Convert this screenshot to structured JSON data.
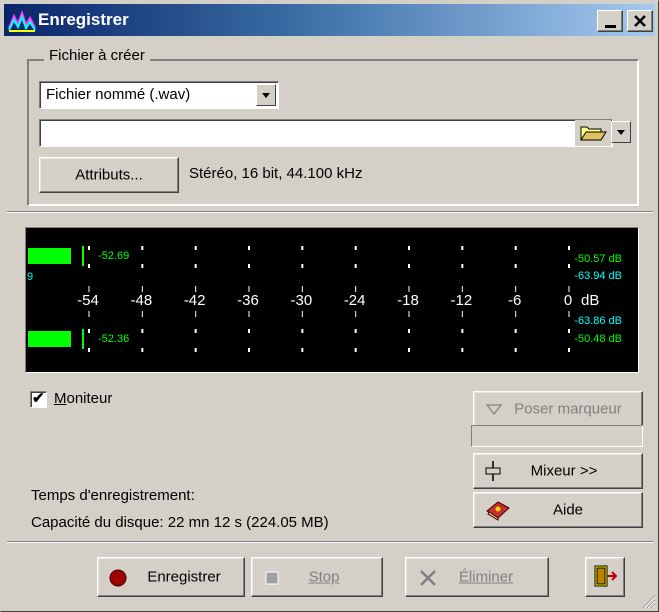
{
  "window": {
    "title": "Enregistrer"
  },
  "file_group": {
    "legend": "Fichier à créer",
    "file_type_value": "Fichier nommé (.wav)",
    "path_value": "",
    "attributes_button": "Attributs...",
    "format_text": "Stéréo, 16 bit, 44.100 kHz"
  },
  "meter": {
    "top_channel_value": "-52.69",
    "bottom_channel_value": "-52.36",
    "left_edge_label": "9",
    "scale_ticks": [
      "-54",
      "-48",
      "-42",
      "-36",
      "-30",
      "-24",
      "-18",
      "-12",
      "-6",
      "0"
    ],
    "scale_unit": "dB",
    "right_readouts": [
      "-50.57 dB",
      "-63.94 dB",
      "-63.86 dB",
      "-50.48 dB"
    ],
    "top_level_fraction": 0.08,
    "bottom_level_fraction": 0.08,
    "colors": {
      "bar": "#00ff00",
      "peak_text": "#00ff00",
      "avg_text": "#00ffff",
      "scale_text": "#ffffff",
      "background": "#000000"
    }
  },
  "monitor": {
    "label": "Moniteur",
    "checked": true
  },
  "side_buttons": {
    "marker": "Poser marqueur",
    "mixer": "Mixeur >>",
    "help": "Aide"
  },
  "status": {
    "record_time": "Temps d'enregistrement:",
    "disk_capacity": "Capacité du disque: 22 mn 12 s (224.05 MB)"
  },
  "bottom_buttons": {
    "record": "Enregistrer",
    "stop": "Stop",
    "delete": "Éliminer"
  }
}
